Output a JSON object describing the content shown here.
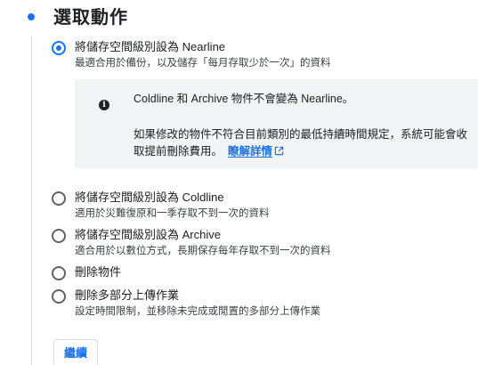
{
  "section": {
    "title": "選取動作"
  },
  "options": [
    {
      "label": "將儲存空間級別設為 Nearline",
      "description": "最適合用於備份，以及儲存「每月存取少於一次」的資料",
      "selected": true
    },
    {
      "label": "將儲存空間級別設為 Coldline",
      "description": "適用於災難復原和一季存取不到一次的資料",
      "selected": false
    },
    {
      "label": "將儲存空間級別設為 Archive",
      "description": "適合用於以數位方式，長期保存每年存取不到一次的資料",
      "selected": false
    },
    {
      "label": "刪除物件",
      "description": "",
      "selected": false
    },
    {
      "label": "刪除多部分上傳作業",
      "description": "設定時間限制，並移除未完成或閒置的多部分上傳作業",
      "selected": false
    }
  ],
  "info": {
    "icon": "info-icon",
    "line1": "Coldline 和 Archive 物件不會變為 Nearline。",
    "line2": "如果修改的物件不符合目前類別的最低持續時間規定，系統可能會收取提前刪除費用。",
    "link_label": "瞭解詳情",
    "link_icon": "external-link-icon"
  },
  "actions": {
    "continue_label": "繼續"
  },
  "colors": {
    "accent": "#1a73e8",
    "info_background": "#f1f3f4",
    "text": "#202124"
  }
}
